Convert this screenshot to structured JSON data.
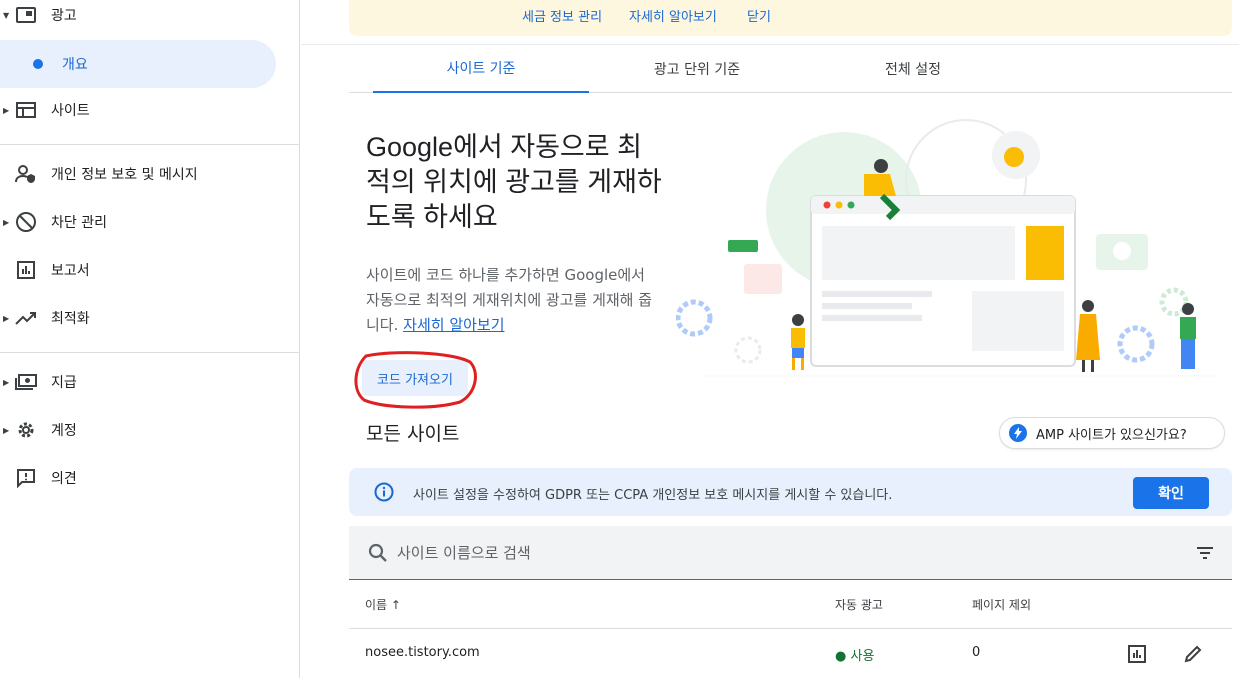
{
  "sidebar": {
    "ads": "광고",
    "overview": "개요",
    "sites": "사이트",
    "privacy": "개인 정보 보호 및 메시지",
    "blocking": "차단 관리",
    "reports": "보고서",
    "optimization": "최적화",
    "payments": "지급",
    "account": "계정",
    "feedback": "의견"
  },
  "banner": {
    "tax": "세금 정보 관리",
    "learn_more": "자세히 알아보기",
    "close": "닫기"
  },
  "tabs": {
    "by_site": "사이트 기준",
    "by_ad_unit": "광고 단위 기준",
    "global": "전체 설정"
  },
  "hero": {
    "title": "Google에서 자동으로 최적의 위치에 광고를 게재하도록 하세요",
    "desc": "사이트에 코드 하나를 추가하면 Google에서 자동으로 최적의 게재위치에 광고를 게재해 줍니다.",
    "learn_more": "자세히 알아보기",
    "get_code": "코드 가져오기"
  },
  "all_sites": "모든 사이트",
  "amp_chip": "AMP 사이트가 있으신가요?",
  "info": {
    "message": "사이트 설정을 수정하여 GDPR 또는 CCPA 개인정보 보호 메시지를 게시할 수 있습니다.",
    "confirm": "확인"
  },
  "search": {
    "placeholder": "사이트 이름으로 검색"
  },
  "table": {
    "col_name": "이름",
    "col_auto_ads": "자동 광고",
    "col_page_exclusions": "페이지 제외",
    "rows": [
      {
        "name": "nosee.tistory.com",
        "auto_ads": "사용",
        "exclusions": "0"
      }
    ]
  },
  "colors": {
    "accent": "#1a73e8",
    "status_on": "#137333",
    "highlight": "#e02020"
  }
}
